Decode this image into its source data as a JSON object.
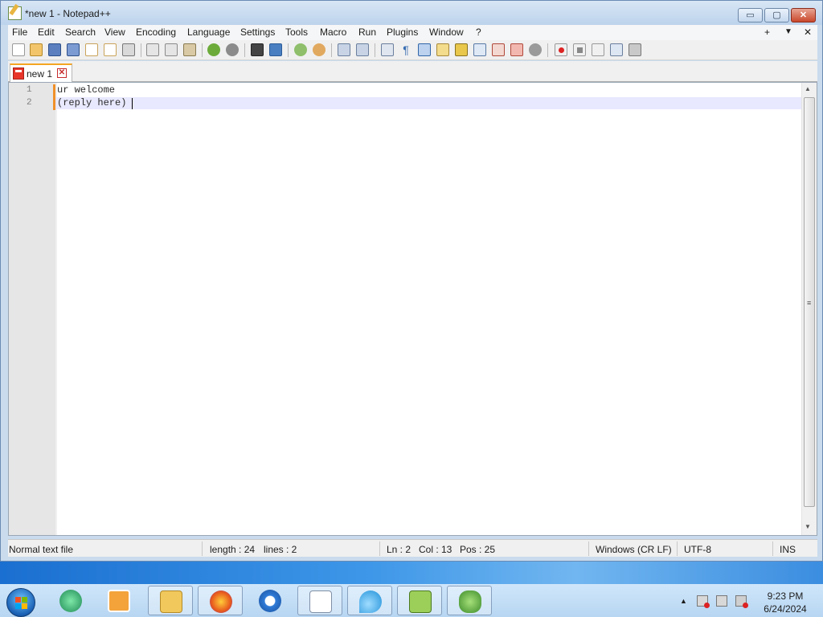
{
  "window": {
    "title": "*new 1 - Notepad++",
    "minimize_label": "▭",
    "maximize_label": "▢",
    "close_label": "✕"
  },
  "menu": {
    "items": [
      "File",
      "Edit",
      "Search",
      "View",
      "Encoding",
      "Language",
      "Settings",
      "Tools",
      "Macro",
      "Run",
      "Plugins",
      "Window",
      "?"
    ],
    "right_plus": "+",
    "right_down": "▼",
    "right_close": "✕"
  },
  "toolbar": {
    "icons": [
      "new-file-icon",
      "open-file-icon",
      "save-icon",
      "save-all-icon",
      "close-icon",
      "close-all-icon",
      "print-icon",
      "cut-icon",
      "copy-icon",
      "paste-icon",
      "undo-icon",
      "redo-icon",
      "find-icon",
      "replace-icon",
      "zoom-in-icon",
      "zoom-out-icon",
      "sync-vertical-icon",
      "sync-horizontal-icon",
      "word-wrap-icon",
      "show-all-chars-icon",
      "indent-guide-icon",
      "user-language-icon",
      "doc-map-icon",
      "function-list-icon",
      "folder-as-workspace-icon",
      "monitoring-icon",
      "record-macro-icon",
      "stop-recording-icon",
      "play-macro-icon",
      "run-macro-multiple-icon",
      "save-macro-icon"
    ]
  },
  "tab": {
    "label": "new 1",
    "close": "✕"
  },
  "editor": {
    "lines": [
      {
        "number": "1",
        "text": "ur welcome"
      },
      {
        "number": "2",
        "text": "(reply here)"
      }
    ]
  },
  "statusbar": {
    "file_type": "Normal text file",
    "length": "length : 24",
    "lines": "lines : 2",
    "ln": "Ln : 2",
    "col": "Col : 13",
    "pos": "Pos : 25",
    "eol": "Windows (CR LF)",
    "encoding": "UTF-8",
    "mode": "INS"
  },
  "taskbar": {
    "time": "9:23 PM",
    "date": "6/24/2024"
  },
  "colors": {
    "accent_orange": "#f0902a",
    "title_bg": "#c9dbed",
    "taskbar_blue": "#2d7fd6"
  }
}
